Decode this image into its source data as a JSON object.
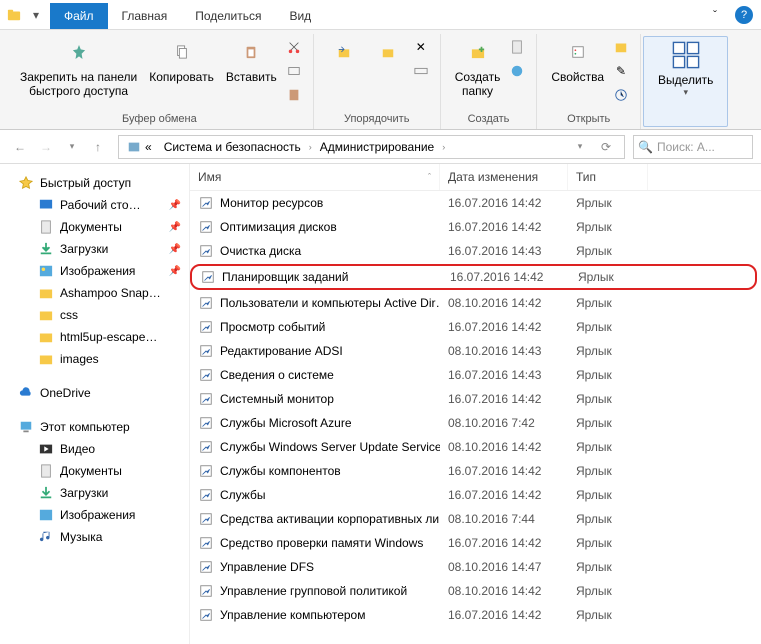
{
  "tabs": {
    "file": "Файл",
    "home": "Главная",
    "share": "Поделиться",
    "view": "Вид"
  },
  "ribbon": {
    "pin": "Закрепить на панели\nбыстрого доступа",
    "copy": "Копировать",
    "paste": "Вставить",
    "clipboard_label": "Буфер обмена",
    "organize_label": "Упорядочить",
    "new_folder": "Создать\nпапку",
    "new_label": "Создать",
    "properties": "Свойства",
    "open_label": "Открыть",
    "select": "Выделить"
  },
  "breadcrumb": {
    "seg1": "Система и безопасность",
    "seg2": "Администрирование"
  },
  "search_placeholder": "Поиск: А...",
  "sidebar": {
    "quick_access": "Быстрый доступ",
    "desktop": "Рабочий сто…",
    "documents": "Документы",
    "downloads": "Загрузки",
    "pictures": "Изображения",
    "ashampoo": "Ashampoo Snap…",
    "css": "css",
    "html5": "html5up-escape…",
    "images": "images",
    "onedrive": "OneDrive",
    "this_pc": "Этот компьютер",
    "video": "Видео",
    "documents2": "Документы",
    "downloads2": "Загрузки",
    "pictures2": "Изображения",
    "music": "Музыка"
  },
  "columns": {
    "name": "Имя",
    "date": "Дата изменения",
    "type": "Тип"
  },
  "files": [
    {
      "name": "Монитор ресурсов",
      "date": "16.07.2016 14:42",
      "type": "Ярлык",
      "hl": false
    },
    {
      "name": "Оптимизация дисков",
      "date": "16.07.2016 14:42",
      "type": "Ярлык",
      "hl": false
    },
    {
      "name": "Очистка диска",
      "date": "16.07.2016 14:43",
      "type": "Ярлык",
      "hl": false
    },
    {
      "name": "Планировщик заданий",
      "date": "16.07.2016 14:42",
      "type": "Ярлык",
      "hl": true
    },
    {
      "name": "Пользователи и компьютеры Active Dir…",
      "date": "08.10.2016 14:42",
      "type": "Ярлык",
      "hl": false
    },
    {
      "name": "Просмотр событий",
      "date": "16.07.2016 14:42",
      "type": "Ярлык",
      "hl": false
    },
    {
      "name": "Редактирование ADSI",
      "date": "08.10.2016 14:43",
      "type": "Ярлык",
      "hl": false
    },
    {
      "name": "Сведения о системе",
      "date": "16.07.2016 14:43",
      "type": "Ярлык",
      "hl": false
    },
    {
      "name": "Системный монитор",
      "date": "16.07.2016 14:42",
      "type": "Ярлык",
      "hl": false
    },
    {
      "name": "Службы Microsoft Azure",
      "date": "08.10.2016 7:42",
      "type": "Ярлык",
      "hl": false
    },
    {
      "name": "Службы Windows Server Update Services",
      "date": "08.10.2016 14:42",
      "type": "Ярлык",
      "hl": false
    },
    {
      "name": "Службы компонентов",
      "date": "16.07.2016 14:42",
      "type": "Ярлык",
      "hl": false
    },
    {
      "name": "Службы",
      "date": "16.07.2016 14:42",
      "type": "Ярлык",
      "hl": false
    },
    {
      "name": "Средства активации корпоративных ли…",
      "date": "08.10.2016 7:44",
      "type": "Ярлык",
      "hl": false
    },
    {
      "name": "Средство проверки памяти Windows",
      "date": "16.07.2016 14:42",
      "type": "Ярлык",
      "hl": false
    },
    {
      "name": "Управление DFS",
      "date": "08.10.2016 14:47",
      "type": "Ярлык",
      "hl": false
    },
    {
      "name": "Управление групповой политикой",
      "date": "08.10.2016 14:42",
      "type": "Ярлык",
      "hl": false
    },
    {
      "name": "Управление компьютером",
      "date": "16.07.2016 14:42",
      "type": "Ярлык",
      "hl": false
    }
  ]
}
